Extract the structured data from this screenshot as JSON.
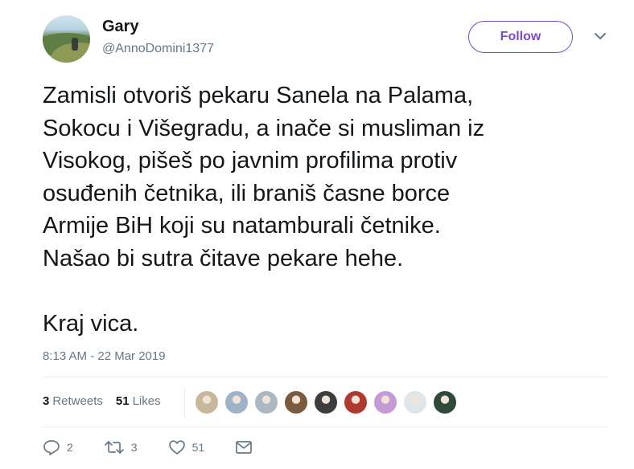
{
  "user": {
    "name": "Gary",
    "handle": "@AnnoDomini1377"
  },
  "follow_label": "Follow",
  "tweet_text": "Zamisli otvoriš pekaru Sanela na Palama,\nSokocu i Višegradu, a inače si musliman iz\nVisokog, pišeš po javnim profilima protiv\nosuđenih četnika, ili braniš časne borce\nArmije BiH koji su natamburali četnike.\nNašao bi sutra čitave pekare hehe.\n\nKraj vica.",
  "timestamp": "8:13 AM - 22 Mar 2019",
  "stats": {
    "retweets_count": "3",
    "retweets_label": "Retweets",
    "likes_count": "51",
    "likes_label": "Likes"
  },
  "likers": [
    {
      "color": "#c8b79a"
    },
    {
      "color": "#9fb3c8"
    },
    {
      "color": "#aab8c2"
    },
    {
      "color": "#7a5b3e"
    },
    {
      "color": "#3d3d3d"
    },
    {
      "color": "#b03a2e"
    },
    {
      "color": "#c49ad6"
    },
    {
      "color": "#dfe6ea"
    },
    {
      "color": "#2f4a3a"
    }
  ],
  "actions": {
    "reply_count": "2",
    "retweet_count": "3",
    "like_count": "51"
  },
  "icons": [
    "reply-icon",
    "retweet-icon",
    "heart-icon",
    "message-icon",
    "chevron-down-icon"
  ],
  "colors": {
    "accent": "#794bc4",
    "secondary_text": "#657786",
    "primary_text": "#14171a",
    "divider": "#e6ecf0"
  }
}
